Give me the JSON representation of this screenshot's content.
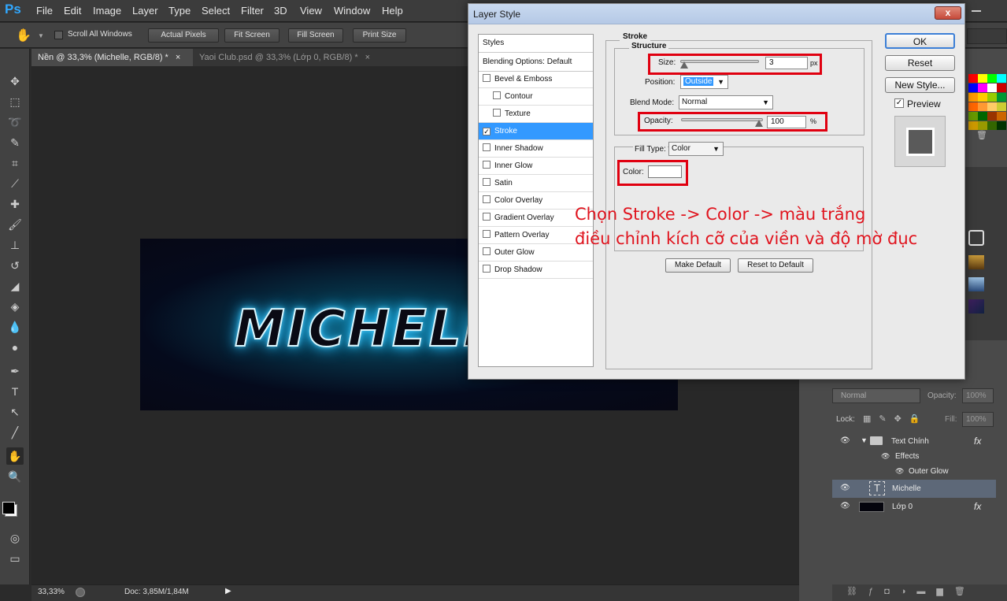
{
  "menubar": {
    "logo": "Ps",
    "items": [
      "File",
      "Edit",
      "Image",
      "Layer",
      "Type",
      "Select",
      "Filter",
      "3D",
      "View",
      "Window",
      "Help"
    ]
  },
  "options_bar": {
    "scroll_all_label": "Scroll All Windows",
    "buttons": [
      "Actual Pixels",
      "Fit Screen",
      "Fill Screen",
      "Print Size"
    ]
  },
  "tabs": [
    {
      "label": "Nền @ 33,3% (Michelle, RGB/8) *",
      "close": "×"
    },
    {
      "label": "Yaoi Club.psd @ 33,3% (Lớp 0, RGB/8) *",
      "close": "×"
    }
  ],
  "canvas": {
    "text": "MICHELLE"
  },
  "status": {
    "zoom": "33,33%",
    "doc": "Doc: 3,85M/1,84M"
  },
  "dialog": {
    "title": "Layer Style",
    "close": "x",
    "styles_header": "Styles",
    "blending": "Blending Options: Default",
    "styles": [
      {
        "label": "Bevel & Emboss",
        "checked": false,
        "indent": false
      },
      {
        "label": "Contour",
        "checked": false,
        "indent": true
      },
      {
        "label": "Texture",
        "checked": false,
        "indent": true
      },
      {
        "label": "Stroke",
        "checked": true,
        "indent": false,
        "selected": true
      },
      {
        "label": "Inner Shadow",
        "checked": false,
        "indent": false
      },
      {
        "label": "Inner Glow",
        "checked": false,
        "indent": false
      },
      {
        "label": "Satin",
        "checked": false,
        "indent": false
      },
      {
        "label": "Color Overlay",
        "checked": false,
        "indent": false
      },
      {
        "label": "Gradient Overlay",
        "checked": false,
        "indent": false
      },
      {
        "label": "Pattern Overlay",
        "checked": false,
        "indent": false
      },
      {
        "label": "Outer Glow",
        "checked": false,
        "indent": false
      },
      {
        "label": "Drop Shadow",
        "checked": false,
        "indent": false
      }
    ],
    "stroke_title": "Stroke",
    "structure_title": "Structure",
    "size_label": "Size:",
    "size_value": "3",
    "size_unit": "px",
    "position_label": "Position:",
    "position_value": "Outside",
    "blend_label": "Blend Mode:",
    "blend_value": "Normal",
    "opacity_label": "Opacity:",
    "opacity_value": "100",
    "opacity_unit": "%",
    "opacity_level": 1.0,
    "size_level": 0.0,
    "fill_type_label": "Fill Type:",
    "fill_type_value": "Color",
    "color_label": "Color:",
    "stroke_color": "#ffffff",
    "make_default": "Make Default",
    "reset_default": "Reset to Default",
    "ok": "OK",
    "reset": "Reset",
    "new_style": "New Style...",
    "preview_label": "Preview",
    "preview_checked": "✓",
    "annotation_line1": "Chọn Stroke -> Color -> màu trắng",
    "annotation_line2": "điều chỉnh kích cỡ của viền và độ mờ đục"
  },
  "layers_panel": {
    "blend": "Normal",
    "opacity_label": "Opacity:",
    "opacity_value": "100%",
    "lock_label": "Lock:",
    "fill_label": "Fill:",
    "fill_value": "100%",
    "layers": [
      {
        "name": "Text Chính",
        "type": "group",
        "fx": "fx"
      },
      {
        "name": "Effects",
        "type": "effect"
      },
      {
        "name": "Outer Glow",
        "type": "effect"
      },
      {
        "name": "Michelle",
        "type": "text",
        "selected": true
      },
      {
        "name": "Lớp 0",
        "type": "fill",
        "fx": "fx"
      }
    ]
  },
  "colors": {
    "accent": "#3399ff",
    "highlight": "#e00010",
    "swatches": [
      "#ff0000",
      "#ffff00",
      "#00ff00",
      "#00ffff",
      "#0000ff",
      "#ff00ff",
      "#ffffff",
      "#cc0000",
      "#ff9900",
      "#ffcc00",
      "#99cc00",
      "#009933",
      "#ff6600",
      "#ff9933",
      "#ffcc66",
      "#cccc33",
      "#669900",
      "#006600",
      "#993300",
      "#cc6600",
      "#cc9900",
      "#999900",
      "#336600",
      "#003300"
    ]
  }
}
